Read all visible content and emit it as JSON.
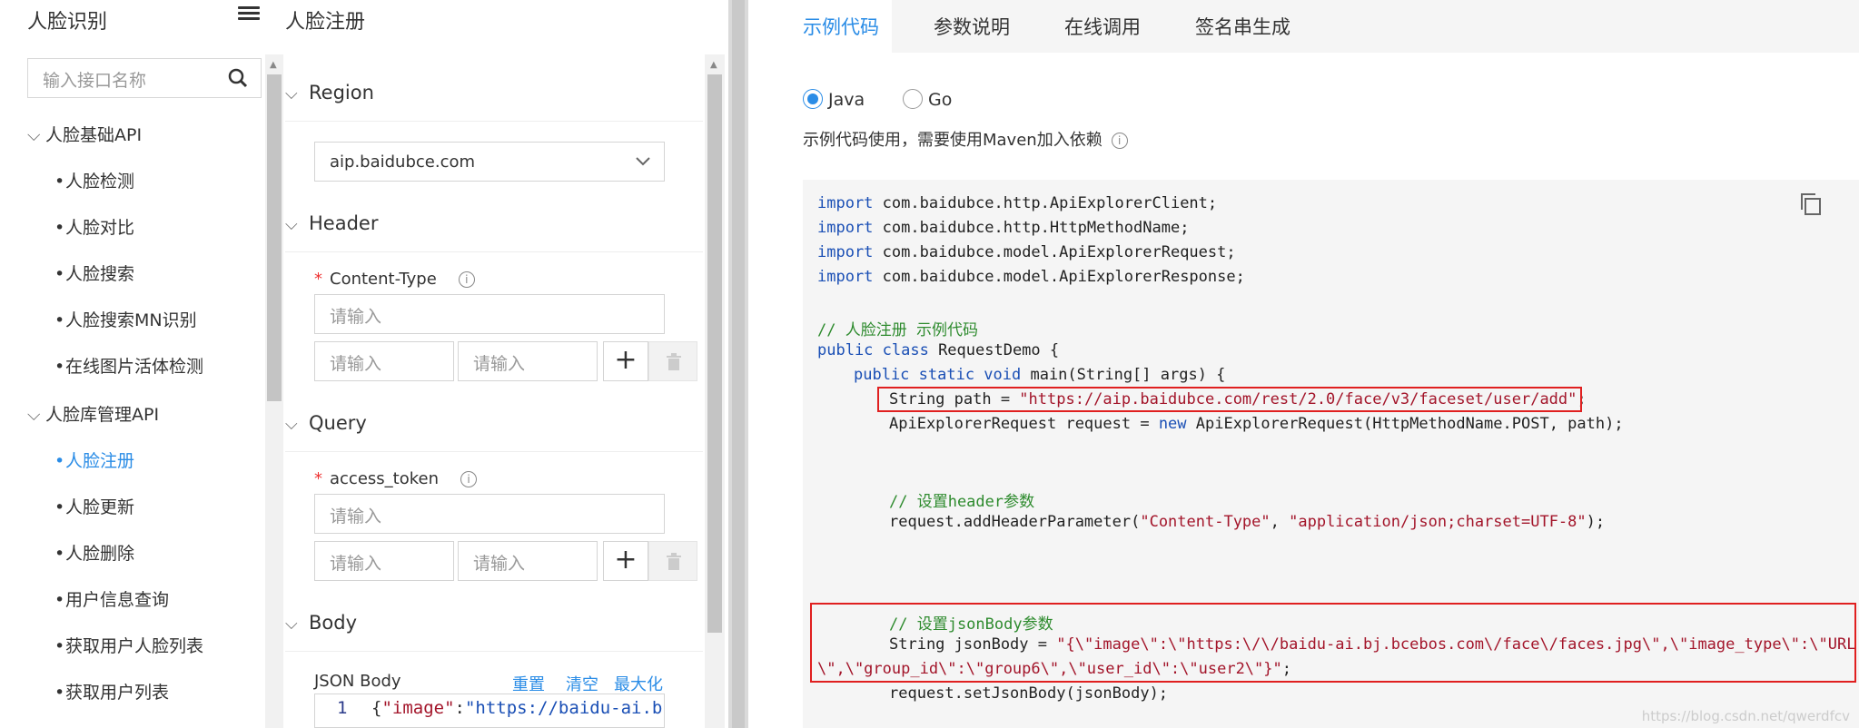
{
  "sidebar": {
    "title": "人脸识别",
    "search_placeholder": "输入接口名称",
    "groups": [
      {
        "label": "人脸基础API",
        "items": [
          "人脸检测",
          "人脸对比",
          "人脸搜索",
          "人脸搜索MN识别",
          "在线图片活体检测"
        ]
      },
      {
        "label": "人脸库管理API",
        "items": [
          "人脸注册",
          "人脸更新",
          "人脸删除",
          "用户信息查询",
          "获取用户人脸列表",
          "获取用户列表"
        ]
      }
    ],
    "active_item": "人脸注册"
  },
  "form": {
    "title": "人脸注册",
    "region": {
      "label": "Region",
      "value": "aip.baidubce.com"
    },
    "header": {
      "label": "Header",
      "field_label": "Content-Type",
      "placeholder": "请输入"
    },
    "query": {
      "label": "Query",
      "field_label": "access_token",
      "placeholder": "请输入"
    },
    "body": {
      "label": "Body",
      "json_label": "JSON Body",
      "actions": [
        "重置",
        "清空",
        "最大化"
      ],
      "line_no": "1",
      "code_key": "\"image\"",
      "code_val": "\"https://baidu-ai.b"
    },
    "add_symbol": "+"
  },
  "tabs": [
    "示例代码",
    "参数说明",
    "在线调用",
    "签名串生成"
  ],
  "active_tab": "示例代码",
  "languages": [
    "Java",
    "Go"
  ],
  "selected_language": "Java",
  "note": "示例代码使用，需要使用Maven加入依赖",
  "code": {
    "imports": [
      "com.baidubce.http.ApiExplorerClient;",
      "com.baidubce.http.HttpMethodName;",
      "com.baidubce.model.ApiExplorerRequest;",
      "com.baidubce.model.ApiExplorerResponse;"
    ],
    "kw_import": "import",
    "comment1": "// 人脸注册 示例代码",
    "class_line": [
      "public class",
      " RequestDemo {"
    ],
    "main_line": [
      "public static void",
      " main(String[] args) {"
    ],
    "path_line": [
      "String path = ",
      "\"https://aip.baidubce.com/rest/2.0/face/v3/faceset/user/add\"",
      ";"
    ],
    "request_line": [
      "ApiExplorerRequest request = ",
      "new",
      " ApiExplorerRequest(HttpMethodName.POST, path);"
    ],
    "comment2": "// 设置header参数",
    "header_line": [
      "request.addHeaderParameter(",
      "\"Content-Type\"",
      ", ",
      "\"application/json;charset=UTF-8\"",
      ");"
    ],
    "comment3": "// 设置jsonBody参数",
    "json_line1": [
      "String jsonBody = ",
      "\"{\\\"image\\\":\\\"https:\\/\\/baidu-ai.bj.bcebos.com\\/face\\/faces.jpg\\\",\\\"image_type\\\":\\\"URL"
    ],
    "json_line2": "\\\",\\\"group_id\\\":\\\"group6\\\",\\\"user_id\\\":\\\"user2\\\"}\"",
    "json_line2_end": ";",
    "set_body_line": "request.setJsonBody(jsonBody);"
  },
  "watermark": "https://blog.csdn.net/qwerdfcv",
  "colors": {
    "accent": "#2a8ce6",
    "highlight": "#e02020"
  }
}
